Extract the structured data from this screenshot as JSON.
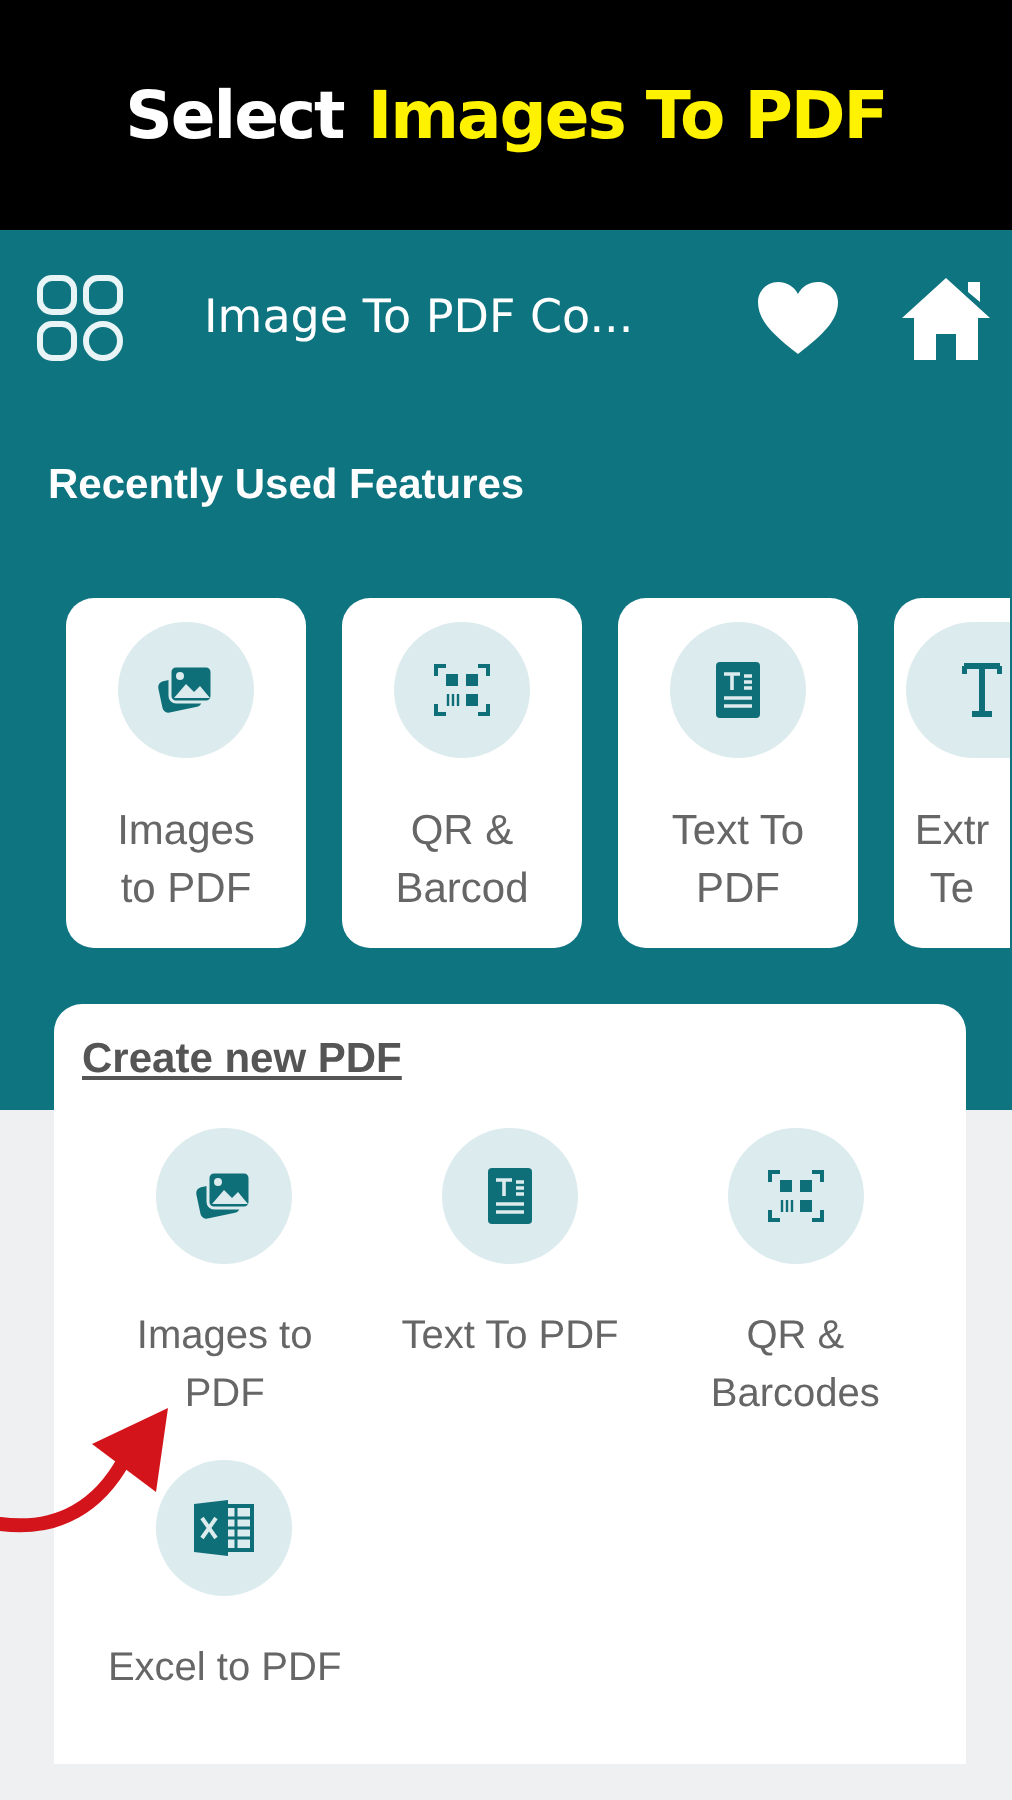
{
  "banner": {
    "parts": [
      {
        "text": "Select",
        "highlight": false
      },
      {
        "text": "Images To PDF",
        "highlight": true
      }
    ]
  },
  "app_bar": {
    "title": "Image To PDF Co..."
  },
  "recent": {
    "title": "Recently Used Features",
    "items": [
      {
        "label": "Images to PDF",
        "kind": "image"
      },
      {
        "label": "QR & Barcod",
        "kind": "qr"
      },
      {
        "label": "Text To PDF",
        "kind": "text"
      },
      {
        "label": "Extr Te",
        "kind": "extract"
      }
    ]
  },
  "create": {
    "title": "Create new PDF",
    "items": [
      {
        "label": "Images to PDF",
        "kind": "image"
      },
      {
        "label": "Text To PDF",
        "kind": "text"
      },
      {
        "label": "QR & Barcodes",
        "kind": "qr"
      },
      {
        "label": "Excel to PDF",
        "kind": "excel"
      }
    ]
  }
}
